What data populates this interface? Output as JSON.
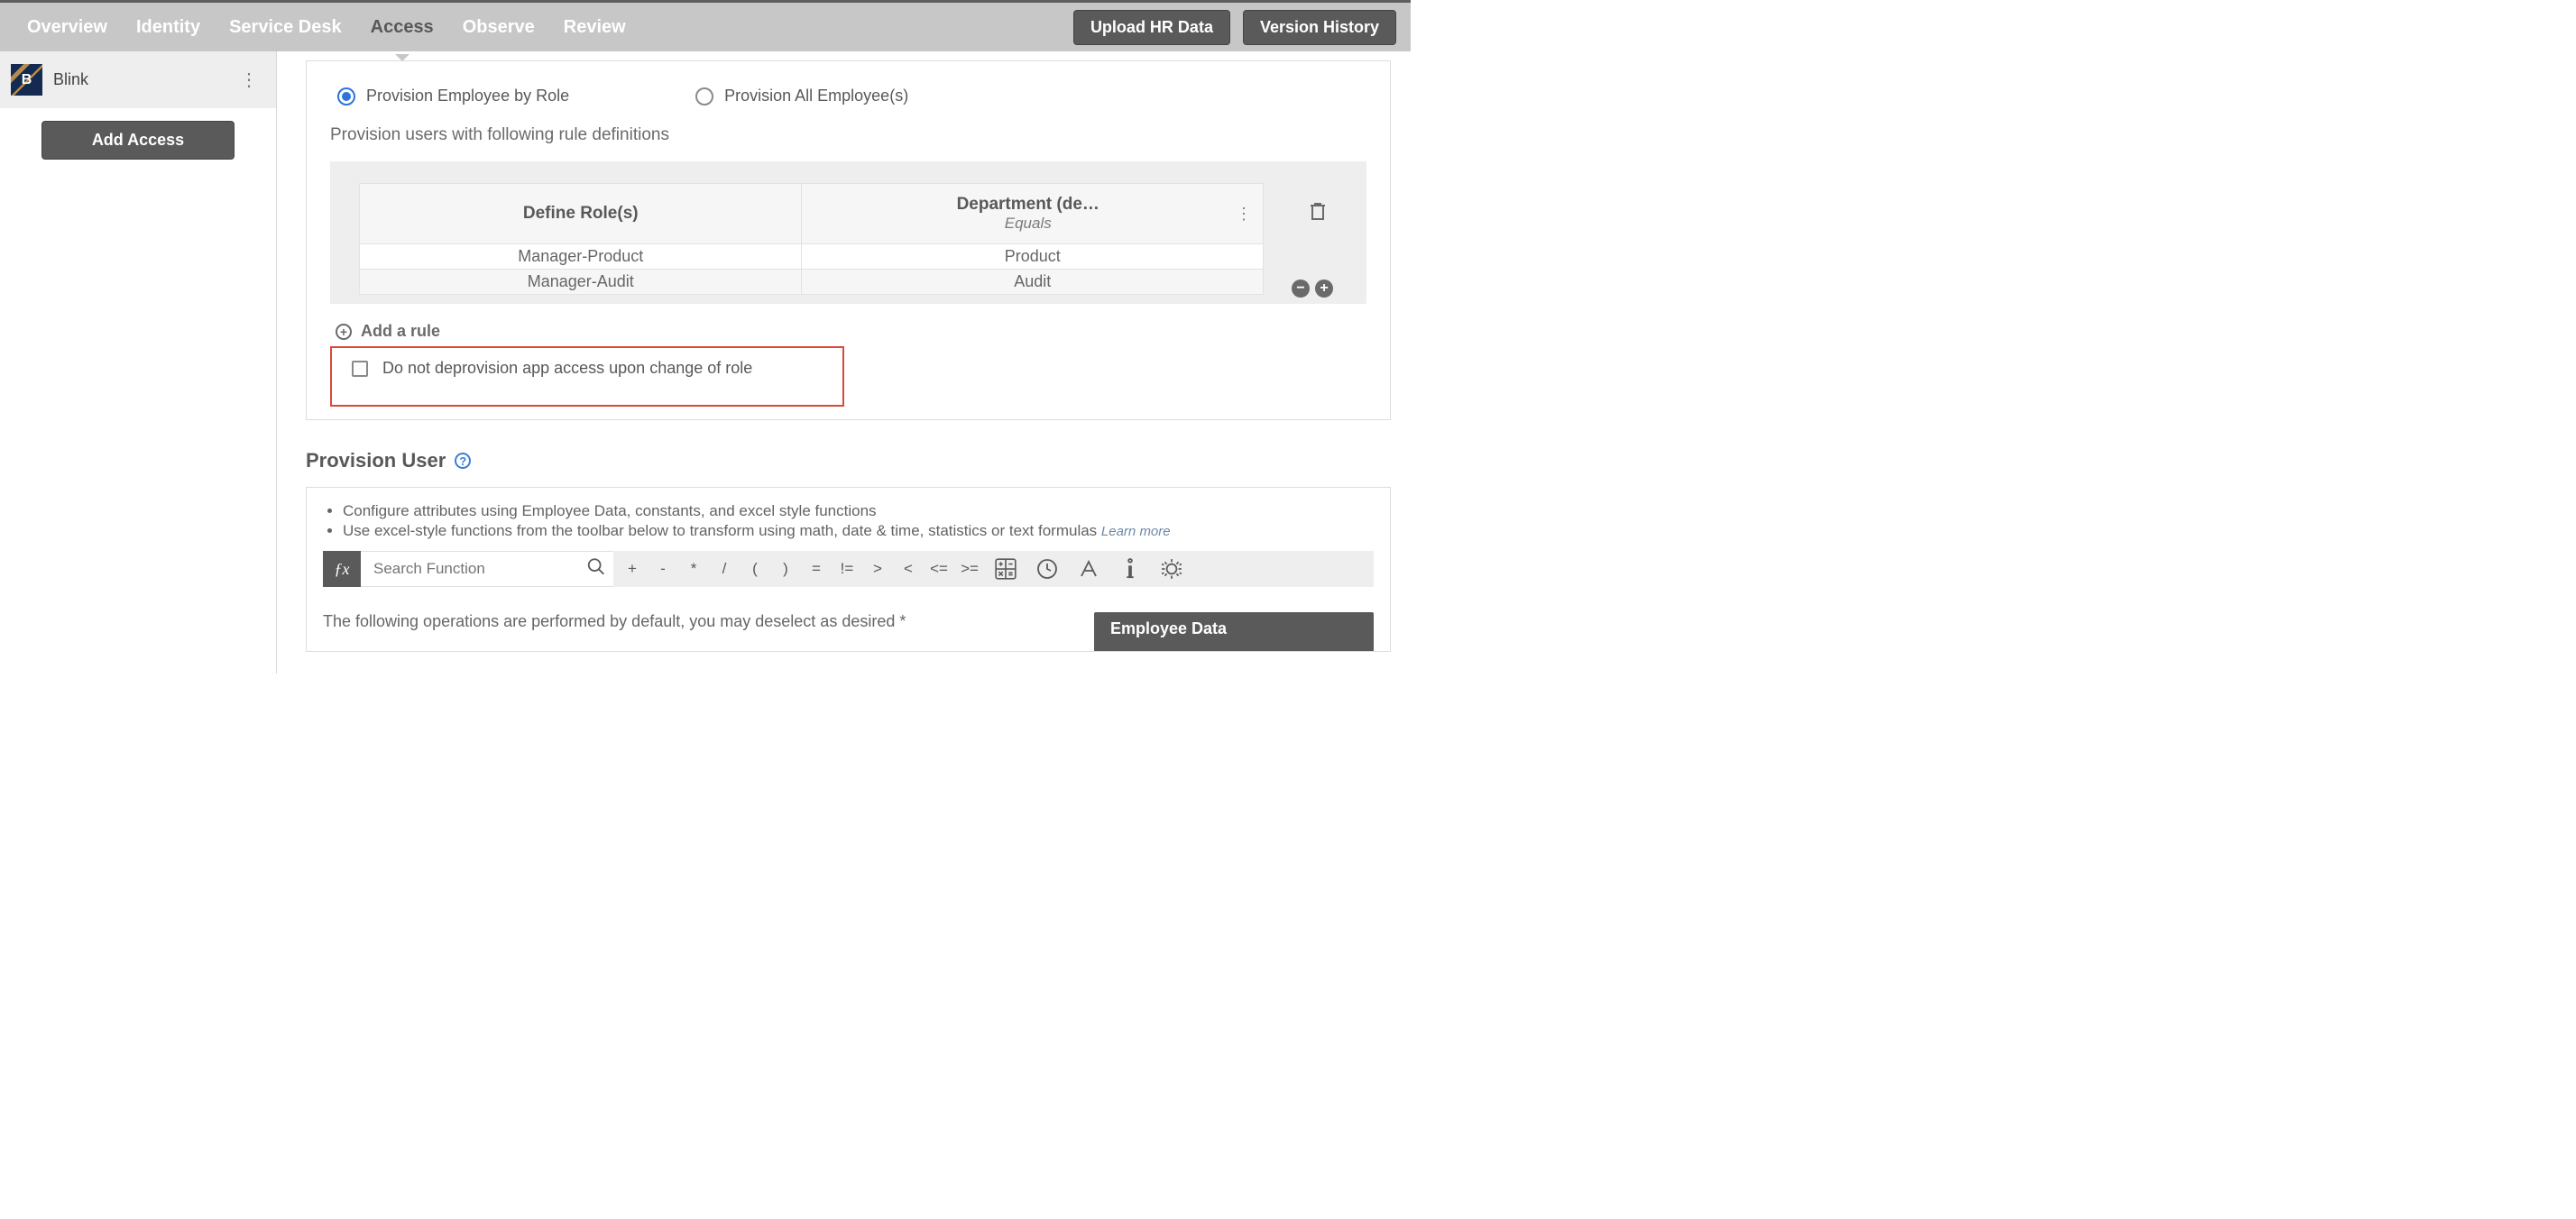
{
  "nav": {
    "tabs": [
      {
        "label": "Overview"
      },
      {
        "label": "Identity"
      },
      {
        "label": "Service Desk"
      },
      {
        "label": "Access",
        "active": true
      },
      {
        "label": "Observe"
      },
      {
        "label": "Review"
      }
    ],
    "upload_btn": "Upload HR Data",
    "version_btn": "Version History"
  },
  "sidebar": {
    "app_name": "Blink",
    "add_access_label": "Add Access"
  },
  "provision_mode": {
    "by_role": "Provision Employee by Role",
    "all": "Provision All Employee(s)",
    "selected": "by_role"
  },
  "rule_block": {
    "subhead": "Provision users with following rule definitions",
    "col1_header": "Define Role(s)",
    "col2_title": "Department (de…",
    "col2_sub": "Equals",
    "rows": [
      {
        "role": "Manager-Product",
        "dept": "Product"
      },
      {
        "role": "Manager-Audit",
        "dept": "Audit"
      }
    ],
    "add_rule_label": "Add a rule"
  },
  "highlight": {
    "checkbox_label": "Do not deprovision app access upon change of role",
    "checked": false
  },
  "section2": {
    "title": "Provision User",
    "bullet1": "Configure attributes using Employee Data, constants, and excel style functions",
    "bullet2": "Use excel-style functions from the toolbar below to transform using math, date & time, statistics or text formulas ",
    "learn_more": "Learn more",
    "fx_placeholder": "Search Function",
    "fx_tag": "ƒx",
    "ops": [
      "+",
      "-",
      "*",
      "/",
      "(",
      ")",
      "=",
      "!=",
      ">",
      "<",
      "<=",
      ">="
    ],
    "bottom_text": "The following operations are performed by default, you may deselect as desired *",
    "emp_data_btn": "Employee Data"
  }
}
